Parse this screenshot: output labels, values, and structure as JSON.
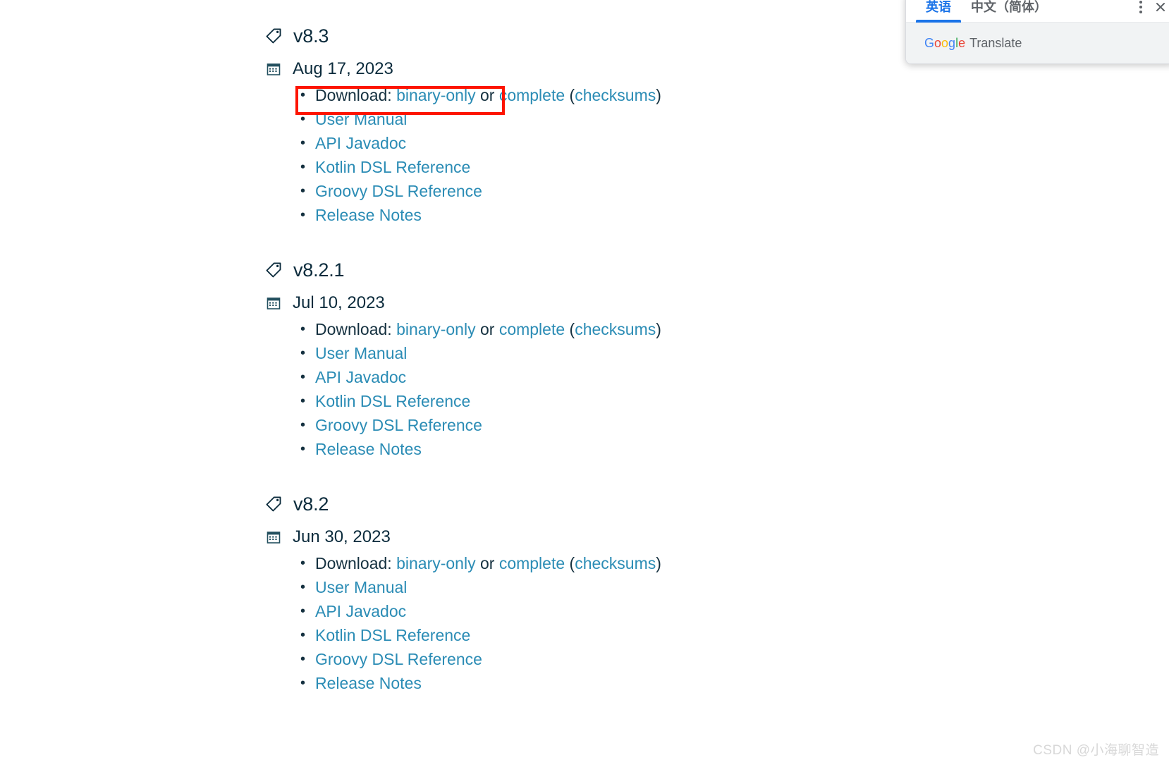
{
  "releases": [
    {
      "version": "v8.3",
      "date": "Aug 17, 2023",
      "download_prefix": "Download:",
      "binary_label": "binary-only",
      "or_label": "or",
      "complete_label": "complete",
      "paren_open": "(",
      "checksums_label": "checksums",
      "paren_close": ")",
      "links": [
        "User Manual",
        "API Javadoc",
        "Kotlin DSL Reference",
        "Groovy DSL Reference",
        "Release Notes"
      ]
    },
    {
      "version": "v8.2.1",
      "date": "Jul 10, 2023",
      "download_prefix": "Download:",
      "binary_label": "binary-only",
      "or_label": "or",
      "complete_label": "complete",
      "paren_open": "(",
      "checksums_label": "checksums",
      "paren_close": ")",
      "links": [
        "User Manual",
        "API Javadoc",
        "Kotlin DSL Reference",
        "Groovy DSL Reference",
        "Release Notes"
      ]
    },
    {
      "version": "v8.2",
      "date": "Jun 30, 2023",
      "download_prefix": "Download:",
      "binary_label": "binary-only",
      "or_label": "or",
      "complete_label": "complete",
      "paren_open": "(",
      "checksums_label": "checksums",
      "paren_close": ")",
      "links": [
        "User Manual",
        "API Javadoc",
        "Kotlin DSL Reference",
        "Groovy DSL Reference",
        "Release Notes"
      ]
    }
  ],
  "translate_popup": {
    "tabs": [
      {
        "label": "英语",
        "active": true
      },
      {
        "label": "中文（简体）",
        "active": false
      }
    ],
    "kebab_icon": "more-vertical-icon",
    "close_icon": "close-icon",
    "footer_brand_letters": [
      "G",
      "o",
      "o",
      "g",
      "l",
      "e"
    ],
    "footer_word": "Translate"
  },
  "annotation": {
    "highlight_color": "#fd1400",
    "target": "download-line-v8-3"
  },
  "watermark": "CSDN @小海聊智造",
  "colors": {
    "link": "#2b8cb5",
    "text": "#14303f",
    "heading": "#0b2b3c",
    "accent_blue": "#1a73e8",
    "popup_footer_bg": "#f1f3f4"
  }
}
